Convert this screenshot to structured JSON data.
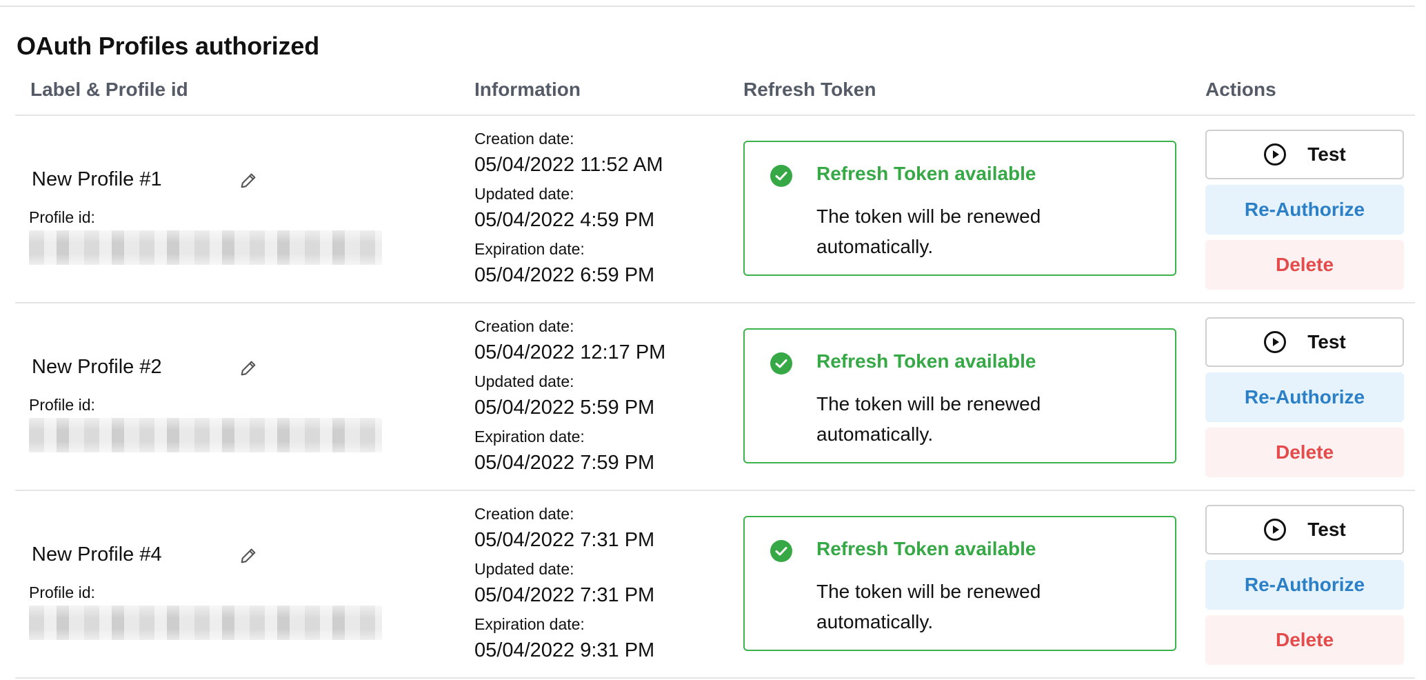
{
  "section_title": "OAuth Profiles authorized",
  "columns": {
    "label": "Label & Profile id",
    "information": "Information",
    "refresh_token": "Refresh Token",
    "actions": "Actions"
  },
  "profile_id_label": "Profile id:",
  "info_labels": {
    "creation": "Creation date:",
    "updated": "Updated date:",
    "expiration": "Expiration date:"
  },
  "token": {
    "title": "Refresh Token available",
    "description": "The token will be renewed automatically."
  },
  "buttons": {
    "test": "Test",
    "reauthorize": "Re-Authorize",
    "delete": "Delete"
  },
  "colors": {
    "success": "#36a845",
    "reauthorize_text": "#2a7fc7",
    "reauthorize_bg": "#e6f3fd",
    "delete_text": "#e44b4b",
    "delete_bg": "#fdf1f1"
  },
  "icons": [
    "edit-pencil-icon",
    "check-circle-icon",
    "play-circle-icon"
  ],
  "profiles": [
    {
      "name": "New Profile #1",
      "creation_date": "05/04/2022 11:52 AM",
      "updated_date": "05/04/2022 4:59 PM",
      "expiration_date": "05/04/2022 6:59 PM"
    },
    {
      "name": "New Profile #2",
      "creation_date": "05/04/2022 12:17 PM",
      "updated_date": "05/04/2022 5:59 PM",
      "expiration_date": "05/04/2022 7:59 PM"
    },
    {
      "name": "New Profile #4",
      "creation_date": "05/04/2022 7:31 PM",
      "updated_date": "05/04/2022 7:31 PM",
      "expiration_date": "05/04/2022 9:31 PM"
    }
  ]
}
